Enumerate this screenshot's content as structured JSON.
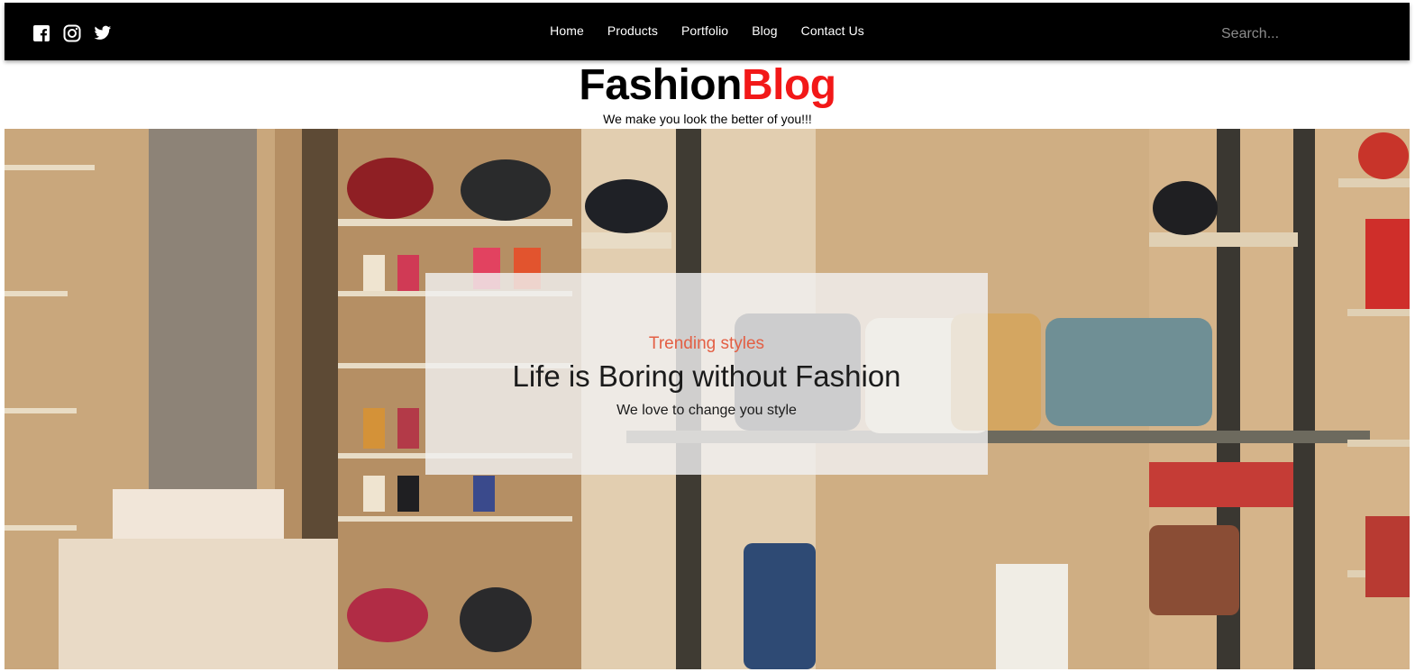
{
  "nav": {
    "social": [
      {
        "icon": "facebook-icon"
      },
      {
        "icon": "instagram-icon"
      },
      {
        "icon": "twitter-icon"
      }
    ],
    "links": [
      "Home",
      "Products",
      "Portfolio",
      "Blog",
      "Contact Us"
    ],
    "search_placeholder": "Search..."
  },
  "logo": {
    "part1": "Fashion",
    "part2": "Blog",
    "accent_color": "#f21818"
  },
  "tagline": "We make you look the better of you!!!",
  "hero": {
    "subtitle": "Trending styles",
    "title": "Life is Boring without Fashion",
    "description": "We love to change you style",
    "subtitle_color": "#e35f44"
  }
}
